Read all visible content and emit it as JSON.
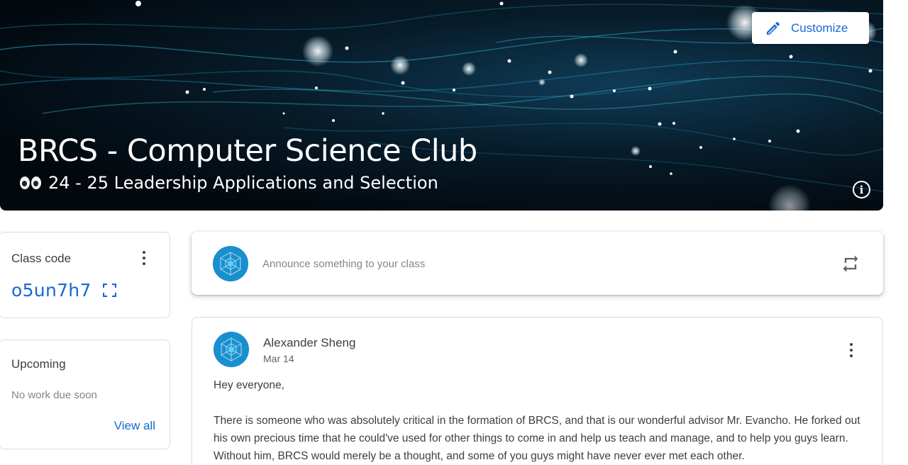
{
  "banner": {
    "title": "BRCS - Computer Science Club",
    "subtitle": "24 - 25 Leadership Applications and Selection",
    "customize_label": "Customize",
    "subtitle_icon": "eyes-emoji-icon",
    "info_icon": "info-icon"
  },
  "class_code": {
    "label": "Class code",
    "value": "o5un7h7",
    "icon": "fullscreen-icon"
  },
  "upcoming": {
    "label": "Upcoming",
    "empty_text": "No work due soon",
    "view_all": "View all"
  },
  "announce": {
    "placeholder": "Announce something to your class",
    "icon": "repost-icon"
  },
  "post": {
    "author": "Alexander Sheng",
    "date": "Mar 14",
    "greeting": "Hey everyone,",
    "paragraph": "There is someone who was absolutely critical in the formation of BRCS, and that is our wonderful advisor Mr. Evancho. He forked out his own precious time that he could've used for other things to come in and help us teach and manage, and to help you guys learn. Without him, BRCS would merely be a thought, and some of you guys might have never ever met each other."
  },
  "colors": {
    "accent": "#1967d2",
    "avatar": "#1a8fce"
  }
}
